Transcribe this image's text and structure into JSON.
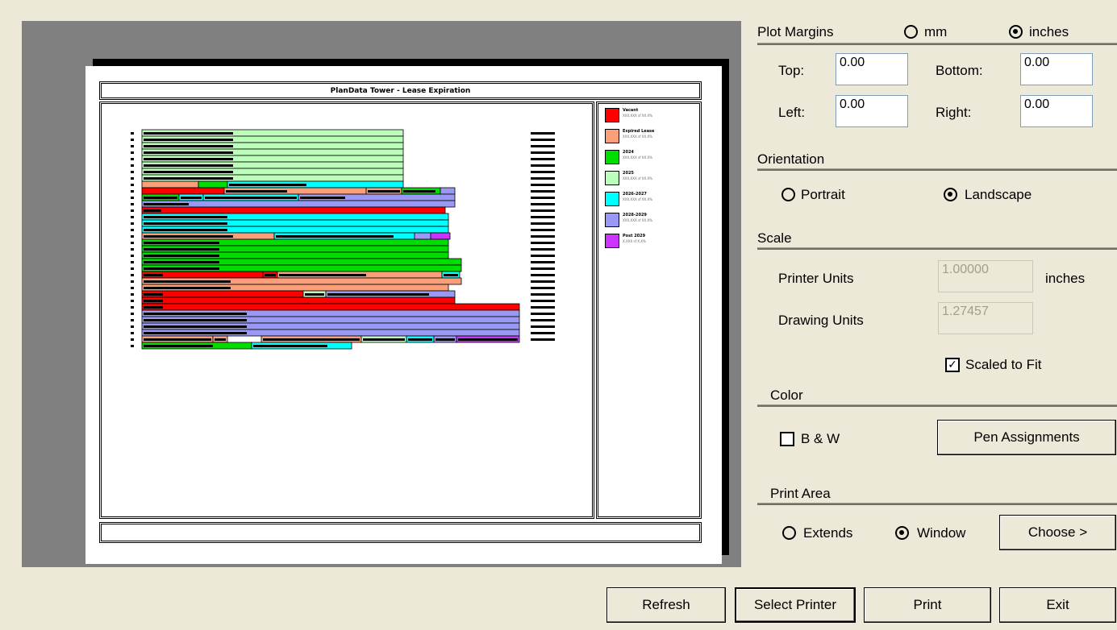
{
  "preview": {
    "title": "PlanData Tower - Lease Expiration",
    "legend": [
      {
        "name": "Vacant",
        "stat": "XXX,XXX sf  XX.X%",
        "color": "#FF0000"
      },
      {
        "name": "Expired Lease",
        "stat": "XXX,XXX sf  XX.X%",
        "color": "#FA9F79"
      },
      {
        "name": "2024",
        "stat": "XXX,XXX sf  XX.X%",
        "color": "#00DD00"
      },
      {
        "name": "2025",
        "stat": "XXX,XXX sf  XX.X%",
        "color": "#BBFFBB"
      },
      {
        "name": "2026-2027",
        "stat": "XXX,XXX sf  XX.X%",
        "color": "#00FFFF"
      },
      {
        "name": "2028-2029",
        "stat": "XXX,XXX sf  XX.X%",
        "color": "#9999F5"
      },
      {
        "name": "Post 2029",
        "stat": "X,XXX sf  X.X%",
        "color": "#CC33FF"
      }
    ]
  },
  "plot_margins": {
    "title": "Plot Margins",
    "unit_mm": "mm",
    "unit_inches": "inches",
    "selected_unit": "inches",
    "top_label": "Top:",
    "top_value": "0.00",
    "bottom_label": "Bottom:",
    "bottom_value": "0.00",
    "left_label": "Left:",
    "left_value": "0.00",
    "right_label": "Right:",
    "right_value": "0.00"
  },
  "orientation": {
    "title": "Orientation",
    "portrait": "Portrait",
    "landscape": "Landscape",
    "selected": "landscape"
  },
  "scale": {
    "title": "Scale",
    "printer_units_label": "Printer Units",
    "printer_units_value": "1.00000",
    "printer_units_unit": "inches",
    "drawing_units_label": "Drawing Units",
    "drawing_units_value": "1.27457",
    "scaled_to_fit_label": "Scaled to Fit",
    "scaled_to_fit": true
  },
  "color": {
    "title": "Color",
    "bw_label": "B & W",
    "bw_checked": false,
    "pen_assignments_label": "Pen Assignments"
  },
  "print_area": {
    "title": "Print Area",
    "extends": "Extends",
    "window": "Window",
    "selected": "window",
    "choose_label": "Choose >"
  },
  "buttons": {
    "refresh": "Refresh",
    "select_printer": "Select Printer",
    "print": "Print",
    "exit": "Exit"
  },
  "colors": {
    "vacant": "#FF0000",
    "expired": "#FA9F79",
    "y2024": "#00DD00",
    "y2025": "#BBFFBB",
    "y2026": "#00FFFF",
    "y2028": "#9999F5",
    "post": "#CC33FF"
  }
}
